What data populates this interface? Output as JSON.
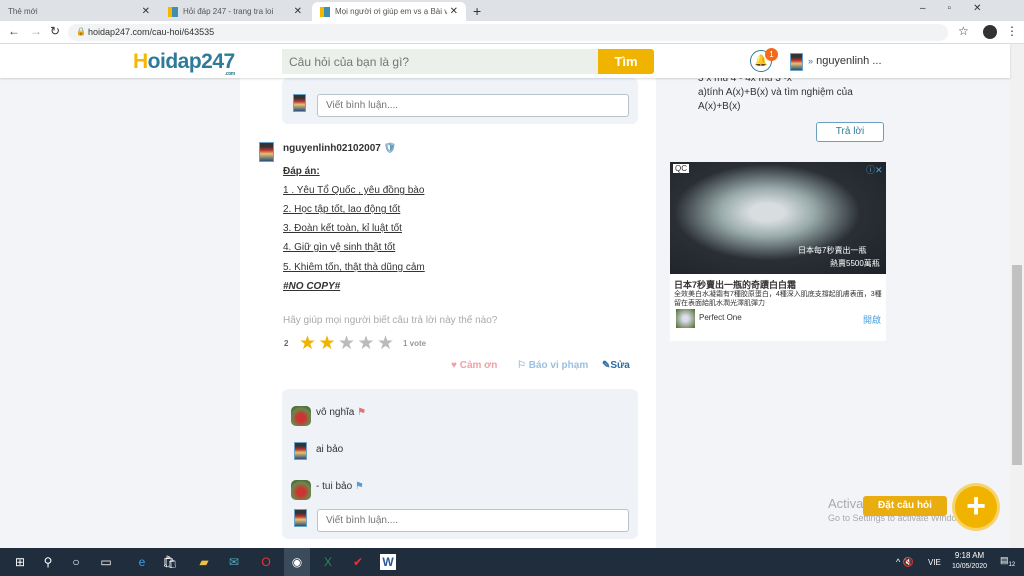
{
  "browser": {
    "tabs": [
      {
        "title": "Thẻ mới"
      },
      {
        "title": "Hỏi đáp 247 - trang tra loi"
      },
      {
        "title": "Mọi người ơi giúp em vs ạ Bài vă"
      }
    ],
    "url": "hoidap247.com/cau-hoi/643535"
  },
  "header": {
    "logo": "Hoidap247",
    "logo_sub": ".com",
    "search_placeholder": "Câu hỏi của bạn là gì?",
    "search_button": "Tìm",
    "notif_count": "1",
    "username": "nguyenlinh ..."
  },
  "comment_placeholder": "Viết bình luận....",
  "answer": {
    "author": "nguyenlinh02102007",
    "heading": "Đáp án:",
    "lines": [
      "1 . Yêu Tổ Quốc , yêu đồng bào",
      "2. Học tập tốt, lao động tốt",
      "3. Đoàn kết toàn, kỉ luật tốt",
      "4. Giữ gìn vệ sinh thật tốt",
      "5. Khiêm tốn, thật thà dũng cảm"
    ],
    "footer": "#NO COPY#",
    "rate_prompt": "Hãy giúp mọi người biết câu trả lời này thế nào?",
    "rating": "2",
    "rating_max": 5,
    "votes": "1 vote",
    "thanks": "Cảm ơn",
    "report": "Báo vi phạm",
    "edit": "Sửa"
  },
  "comments": [
    {
      "text": "vô nghĩa",
      "flag_color": "#e57373"
    },
    {
      "text": "ai bảo"
    },
    {
      "text": "- tui bảo",
      "flag_color": "#5b9bd5"
    }
  ],
  "sidebar": {
    "question_lines": [
      "3 x mũ 4 - 4x mũ 3 -x",
      "a)tính A(x)+B(x) và tìm nghiệm của",
      "A(x)+B(x)"
    ],
    "reply_button": "Trả lời"
  },
  "ad": {
    "label": "QC",
    "caption1": "日本每7秒賣出一瓶",
    "caption2": "熱賣5500萬瓶",
    "title": "日本7秒賣出一瓶的奇蹟白白霜",
    "desc": "全效美白水凝霜有7種胶原蛋白，4種深入肌底支撐起肌膚表面，3種留在表面給肌水潤光澤肌彈力",
    "brand": "Perfect One",
    "open": "開啟"
  },
  "fab": {
    "label": "Đặt câu hỏi"
  },
  "watermark": {
    "line1": "Activate Windows",
    "line2": "Go to Settings to activate Windows."
  },
  "taskbar": {
    "lang": "VIE",
    "time": "9:18 AM",
    "date": "10/05/2020",
    "notif": "12"
  }
}
